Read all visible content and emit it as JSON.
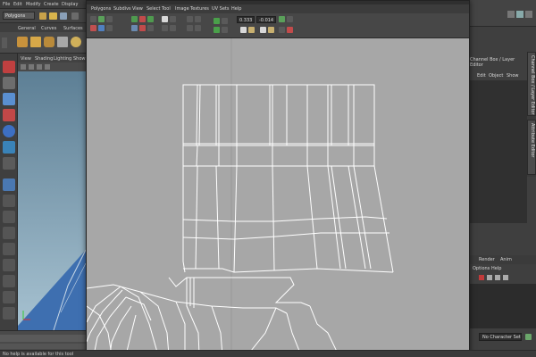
{
  "main_menu": {
    "items": [
      "File",
      "Edit",
      "Modify",
      "Create",
      "Display"
    ]
  },
  "main_toolbar": {
    "menu_set": "Polygons"
  },
  "shelf": {
    "tabs": [
      "General",
      "Curves",
      "Surfaces"
    ]
  },
  "viewport_menu": {
    "items": [
      "View",
      "Shading",
      "Lighting",
      "Show"
    ]
  },
  "uv_editor": {
    "menu": [
      "Polygons",
      "Subdivs",
      "View",
      "Select",
      "Tool",
      "Image",
      "Textures",
      "UV Sets",
      "Help"
    ],
    "u_value": "0.333",
    "v_value": "-0.014"
  },
  "right_panel": {
    "title": "Channel Box / Layer Editor",
    "menu": [
      "Edit",
      "Object",
      "Show"
    ],
    "vtabs": [
      "Channel Box / Layer Editor",
      "Attribute Editor"
    ],
    "layer_tabs": [
      "Render",
      "Anim"
    ],
    "layer_menu": [
      "Options",
      "Help"
    ],
    "character_set": "No Character Set"
  },
  "help_line": {
    "text": "No help is available for this tool"
  },
  "colors": {
    "uv_background": "#a7a7a7",
    "wireframe": "#ffffff",
    "panel": "#444444",
    "field": "#2d2d2d"
  }
}
